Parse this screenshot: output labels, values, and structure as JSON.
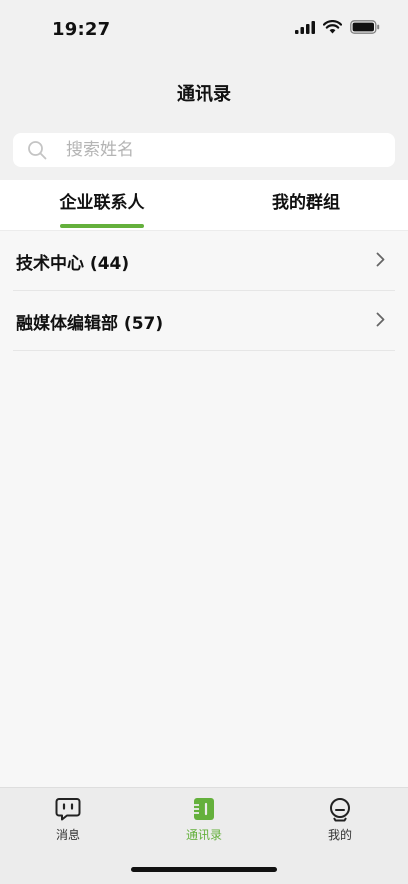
{
  "status_bar": {
    "time": "19:27"
  },
  "header": {
    "title": "通讯录"
  },
  "search": {
    "placeholder": "搜索姓名",
    "value": ""
  },
  "tabs": [
    {
      "label": "企业联系人",
      "active": true
    },
    {
      "label": "我的群组",
      "active": false
    }
  ],
  "departments": [
    {
      "label": "技术中心 (44)"
    },
    {
      "label": "融媒体编辑部 (57)"
    }
  ],
  "bottom_nav": [
    {
      "label": "消息",
      "icon": "message-icon",
      "active": false
    },
    {
      "label": "通讯录",
      "icon": "contacts-icon",
      "active": true
    },
    {
      "label": "我的",
      "icon": "profile-icon",
      "active": false
    }
  ],
  "colors": {
    "accent": "#64b03c"
  }
}
